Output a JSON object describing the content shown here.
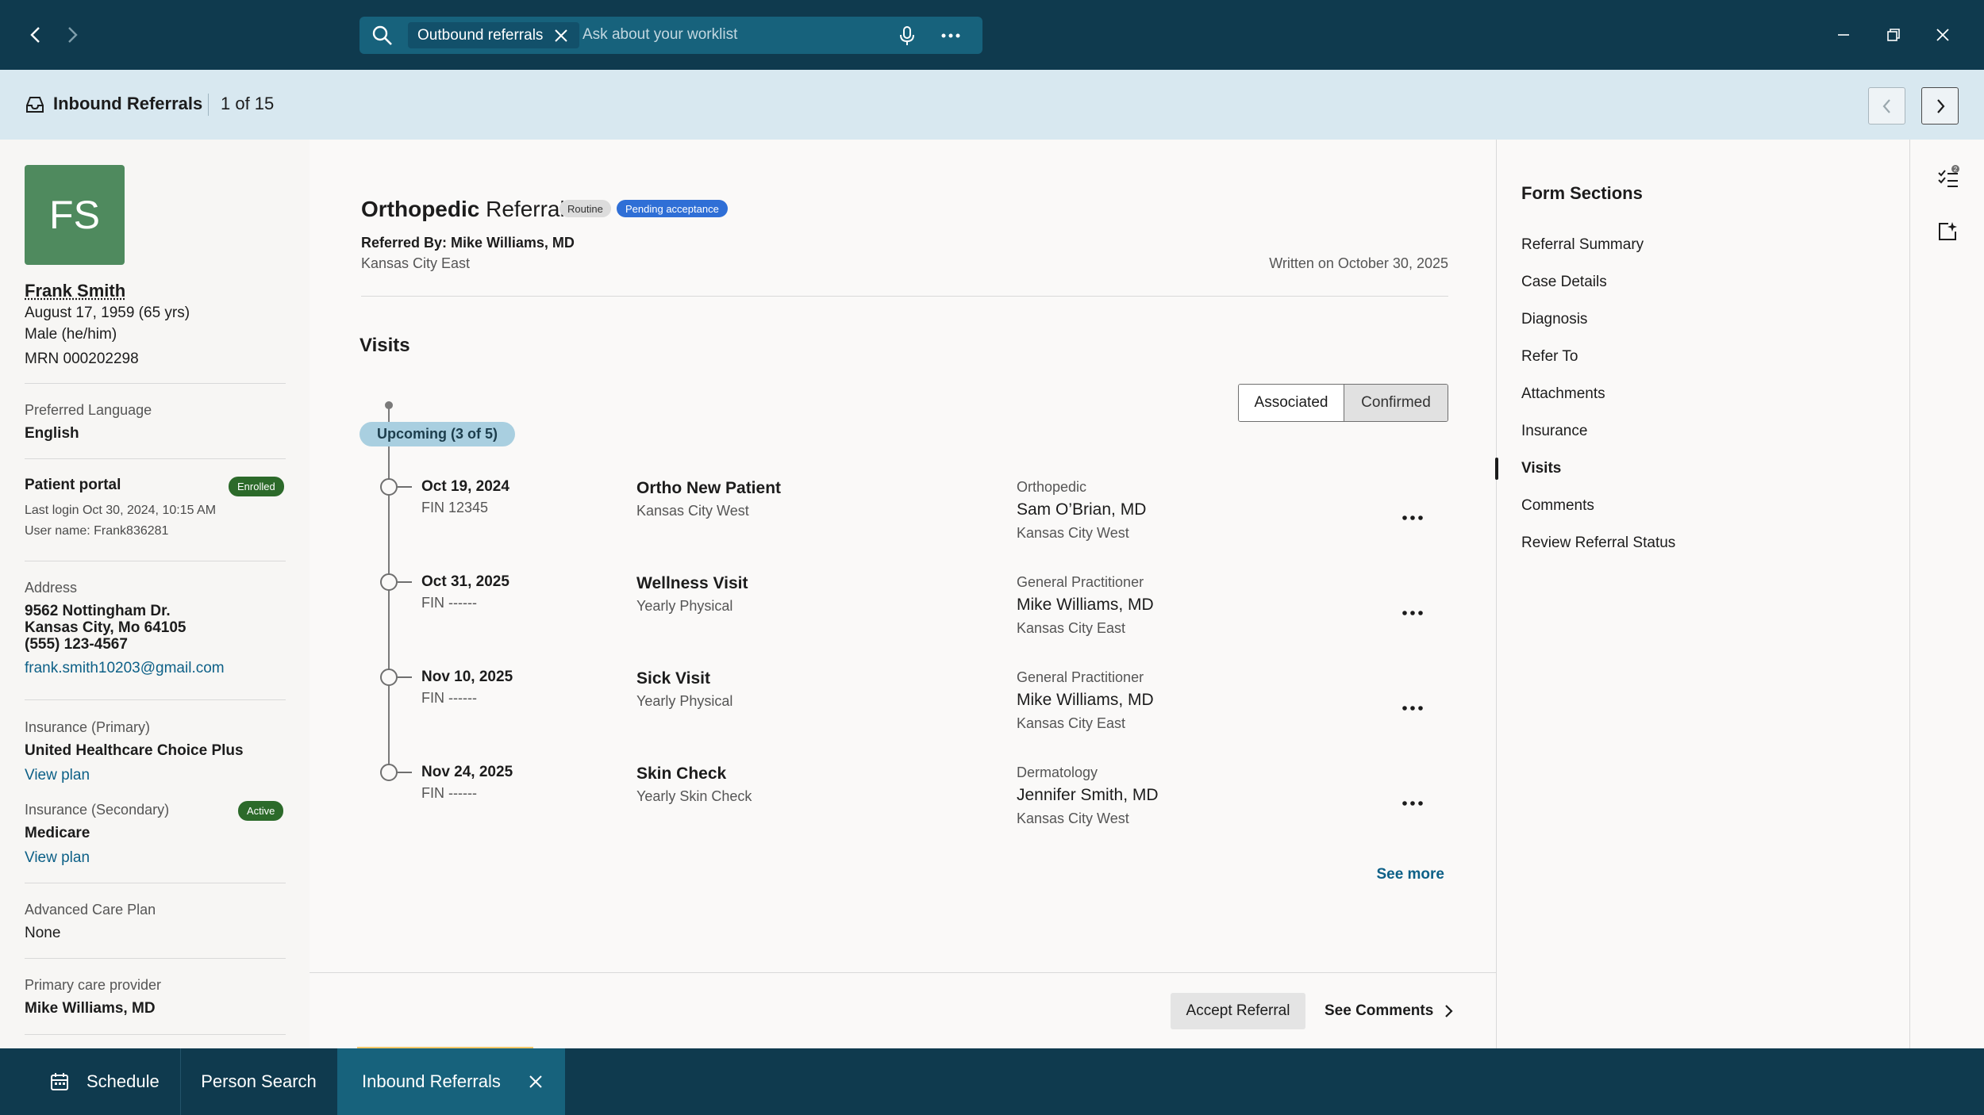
{
  "titlebar": {
    "search_chip": "Outbound referrals",
    "search_placeholder": "Ask about your worklist"
  },
  "header": {
    "title": "Inbound Referrals",
    "count": "1 of 15"
  },
  "patient": {
    "initials": "FS",
    "name": "Frank Smith",
    "dob": "August 17, 1959 (65 yrs)",
    "sex": "Male (he/him)",
    "mrn": "MRN 000202298",
    "preferred_language_label": "Preferred Language",
    "preferred_language": "English",
    "portal_label": "Patient portal",
    "portal_badge": "Enrolled",
    "last_login": "Last login Oct 30, 2024, 10:15 AM",
    "username": "User name: Frank836281",
    "address_label": "Address",
    "address_line1": "9562 Nottingham Dr.",
    "address_line2": "Kansas City, Mo 64105",
    "phone": "(555) 123-4567",
    "email": "frank.smith10203@gmail.com",
    "insurance_primary_label": "Insurance (Primary)",
    "insurance_primary": "United Healthcare Choice Plus",
    "view_plan_1": "View plan",
    "insurance_secondary_label": "Insurance (Secondary)",
    "insurance_secondary_badge": "Active",
    "insurance_secondary": "Medicare",
    "view_plan_2": "View plan",
    "acp_label": "Advanced Care Plan",
    "acp": "None",
    "pcp_label": "Primary care provider",
    "pcp": "Mike Williams, MD"
  },
  "referral": {
    "title_bold": "Orthopedic",
    "title_rest": " Referral",
    "tag_routine": "Routine",
    "tag_status": "Pending acceptance",
    "referred_by": "Referred By: Mike Williams, MD",
    "location": "Kansas City East",
    "written": "Written on October 30, 2025"
  },
  "visits": {
    "title": "Visits",
    "toggle_associated": "Associated",
    "toggle_confirmed": "Confirmed",
    "upcoming": "Upcoming (3 of 5)",
    "items": [
      {
        "date": "Oct 19, 2024",
        "fin": "FIN 12345",
        "name": "Ortho New Patient",
        "sub": "Kansas City West",
        "specialty": "Orthopedic",
        "provider": "Sam O’Brian, MD",
        "location": "Kansas City West"
      },
      {
        "date": "Oct 31, 2025",
        "fin": "FIN ------",
        "name": "Wellness Visit",
        "sub": "Yearly Physical",
        "specialty": "General Practitioner",
        "provider": "Mike Williams, MD",
        "location": "Kansas City East"
      },
      {
        "date": "Nov 10, 2025",
        "fin": "FIN ------",
        "name": "Sick Visit",
        "sub": "Yearly Physical",
        "specialty": "General Practitioner",
        "provider": "Mike Williams, MD",
        "location": "Kansas City East"
      },
      {
        "date": "Nov 24, 2025",
        "fin": "FIN ------",
        "name": "Skin Check",
        "sub": "Yearly Skin Check",
        "specialty": "Dermatology",
        "provider": "Jennifer Smith, MD",
        "location": "Kansas City West"
      }
    ],
    "see_more": "See more"
  },
  "footer": {
    "accept": "Accept Referral",
    "see_comments": "See Comments"
  },
  "form_sections": {
    "title": "Form Sections",
    "items": [
      "Referral Summary",
      "Case Details",
      "Diagnosis",
      "Refer To",
      "Attachments",
      "Insurance",
      "Visits",
      "Comments",
      "Review Referral Status"
    ],
    "active": "Visits"
  },
  "rail": {
    "task_count": "2"
  },
  "taskbar": {
    "schedule": "Schedule",
    "person_search": "Person Search",
    "inbound_referrals": "Inbound Referrals"
  },
  "colors": {
    "titlebar": "#0f3a4e",
    "header": "#d8e8f0",
    "accent_link": "#0d6087",
    "avatar": "#4f8a5e",
    "pending_tag": "#2f6fd6",
    "enrolled_badge": "#2c6a2a"
  }
}
